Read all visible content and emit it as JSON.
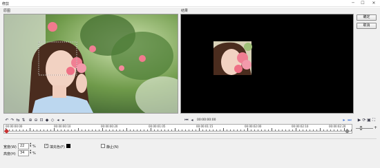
{
  "window": {
    "title": "修剪",
    "minimize": "─",
    "maximize": "☐",
    "close": "✕"
  },
  "panels": {
    "original_label": "原图",
    "result_label": "结果"
  },
  "buttons": {
    "ok": "确定",
    "cancel": "取消"
  },
  "playback": {
    "timecode": "00:00:00:00"
  },
  "timeline": {
    "labels": [
      "00:00:00:00",
      "00:00:00:10",
      "00:00:00:20",
      "00:00:01:05",
      "00:00:01:15",
      "00:00:02:00",
      "00:00:02:10",
      "00:00:02:20"
    ]
  },
  "settings": {
    "width_label": "宽度(W)",
    "width_value": "22",
    "width_unit": "%",
    "height_label": "高度(H)",
    "height_value": "34",
    "height_unit": "%",
    "fill_label": "填充色(F)",
    "fill_checked": "✓",
    "fill_color": "#000000",
    "still_label": "静止(N)"
  },
  "icons": {
    "toolbar_left": [
      "rotate-left-icon",
      "rotate-right-icon",
      "flip-horizontal-icon",
      "flip-vertical-icon",
      "zoom-in-icon",
      "zoom-out-icon",
      "fit-icon",
      "add-keyframe-icon",
      "remove-keyframe-icon",
      "prev-keyframe-icon",
      "next-keyframe-icon"
    ],
    "accent": "#3a6fd8"
  }
}
